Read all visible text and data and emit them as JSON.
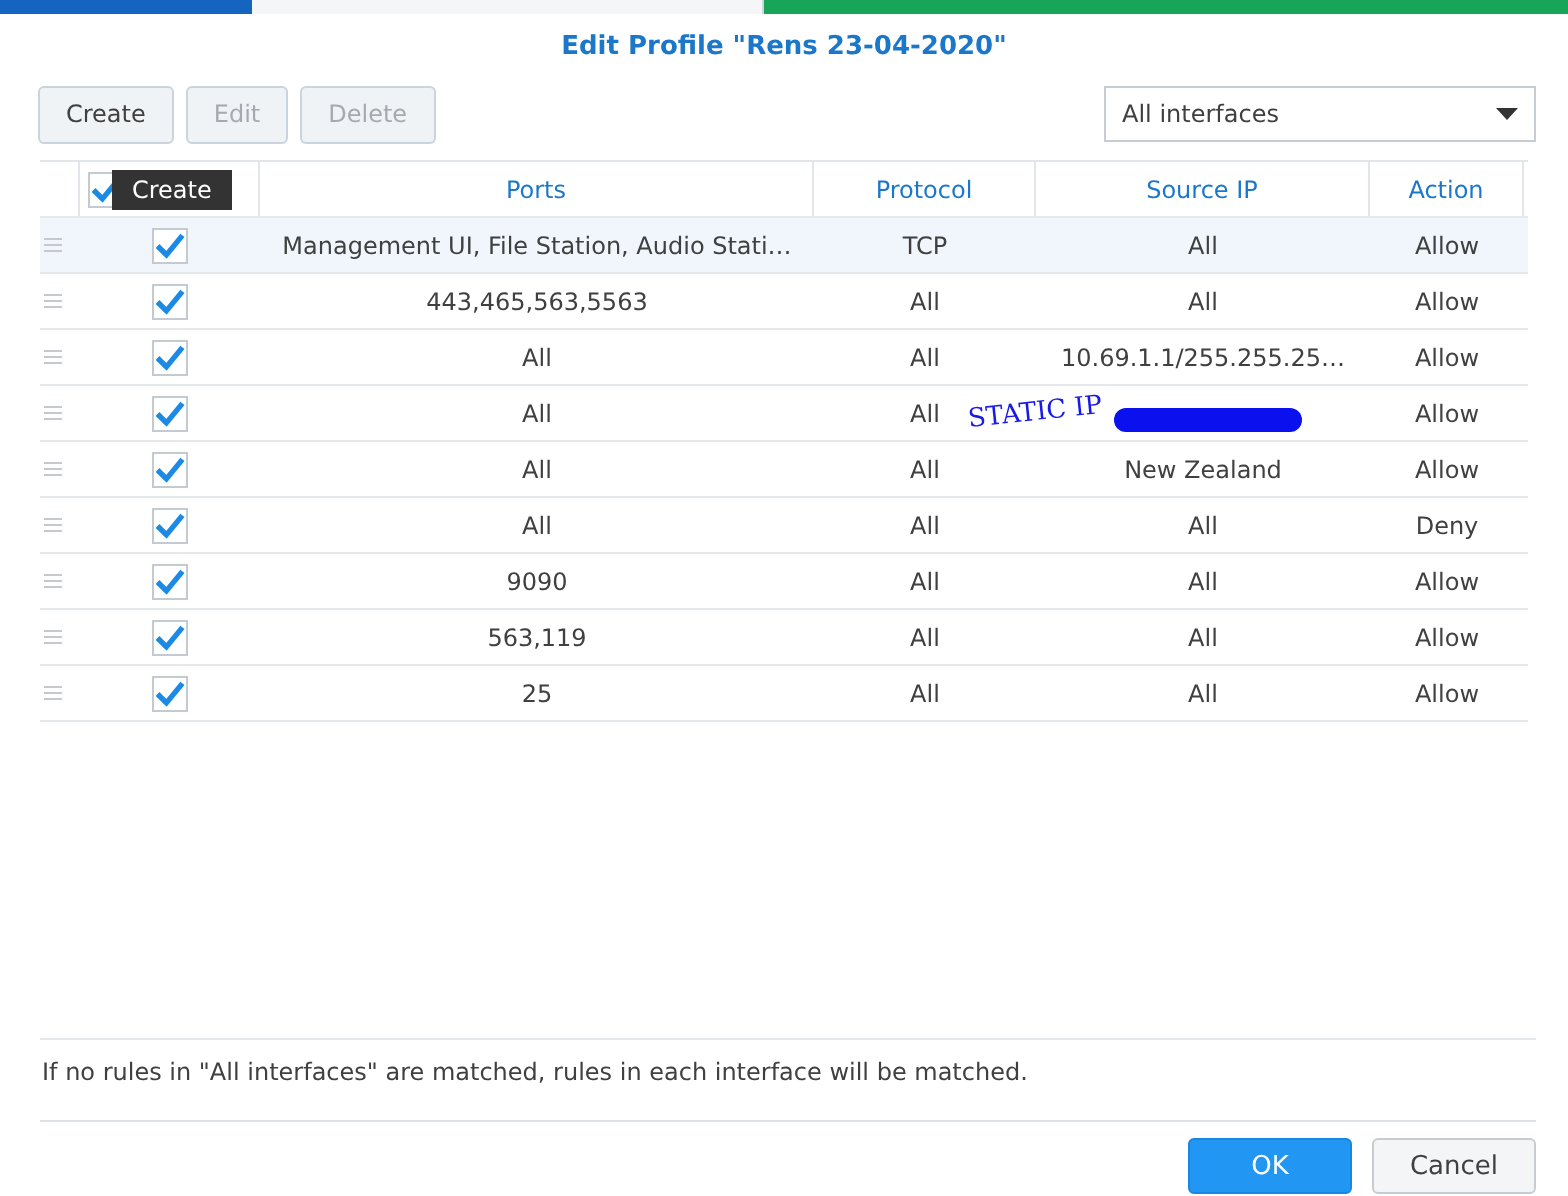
{
  "dialog": {
    "title": "Edit Profile \"Rens 23-04-2020\""
  },
  "toolbar": {
    "buttons": [
      {
        "label": "Create",
        "disabled": false
      },
      {
        "label": "Edit",
        "disabled": true
      },
      {
        "label": "Delete",
        "disabled": true
      }
    ],
    "interface_select": {
      "value": "All interfaces"
    }
  },
  "tooltip": {
    "text": "Create"
  },
  "table": {
    "header_checkbox": {
      "checked": true
    },
    "columns": [
      "Ports",
      "Protocol",
      "Source IP",
      "Action"
    ],
    "rows": [
      {
        "enabled": true,
        "selected": true,
        "ports": "Management UI, File Station, Audio Stati…",
        "protocol": "TCP",
        "source_ip": "All",
        "action": "Allow"
      },
      {
        "enabled": true,
        "selected": false,
        "ports": "443,465,563,5563",
        "protocol": "All",
        "source_ip": "All",
        "action": "Allow"
      },
      {
        "enabled": true,
        "selected": false,
        "ports": "All",
        "protocol": "All",
        "source_ip": "10.69.1.1/255.255.25…",
        "action": "Allow"
      },
      {
        "enabled": true,
        "selected": false,
        "ports": "All",
        "protocol": "All",
        "redacted": true,
        "annotation": "STATIC IP",
        "action": "Allow"
      },
      {
        "enabled": true,
        "selected": false,
        "ports": "All",
        "protocol": "All",
        "source_ip": "New Zealand",
        "action": "Allow"
      },
      {
        "enabled": true,
        "selected": false,
        "ports": "All",
        "protocol": "All",
        "source_ip": "All",
        "action": "Deny"
      },
      {
        "enabled": true,
        "selected": false,
        "ports": "9090",
        "protocol": "All",
        "source_ip": "All",
        "action": "Allow"
      },
      {
        "enabled": true,
        "selected": false,
        "ports": "563,119",
        "protocol": "All",
        "source_ip": "All",
        "action": "Allow"
      },
      {
        "enabled": true,
        "selected": false,
        "ports": "25",
        "protocol": "All",
        "source_ip": "All",
        "action": "Allow"
      }
    ]
  },
  "note": "If no rules in \"All interfaces\" are matched, rules in each interface will be matched.",
  "footer": {
    "buttons": [
      {
        "label": "OK",
        "kind": "primary"
      },
      {
        "label": "Cancel",
        "kind": "secondary"
      }
    ]
  }
}
